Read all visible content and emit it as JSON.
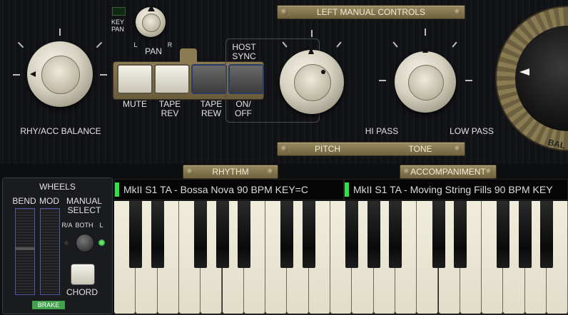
{
  "top": {
    "key_pan_label": "KEY\nPAN",
    "pan_label": "PAN",
    "pan_l": "L",
    "pan_r": "R",
    "rhy_acc_balance_label": "RHY/ACC BALANCE",
    "left_manual_controls_label": "LEFT MANUAL CONTROLS",
    "host_sync_label": "HOST\nSYNC",
    "buttons": [
      {
        "label": "MUTE",
        "state": "on"
      },
      {
        "label": "TAPE\nREV",
        "state": "on"
      },
      {
        "label": "TAPE\nREW",
        "state": "off"
      },
      {
        "label": "ON/\nOFF",
        "state": "off"
      }
    ],
    "hi_pass_label": "HI PASS",
    "low_pass_label": "LOW PASS",
    "pitch_label": "PITCH",
    "tone_label": "TONE",
    "balance_partial_label": "BAL"
  },
  "sections": {
    "rhythm_label": "RHYTHM",
    "accompaniment_label": "ACCOMPANIMENT"
  },
  "displays": {
    "rhythm_text": "MkII S1 TA - Bossa Nova 90 BPM KEY=C",
    "accompaniment_text": "MkII S1 TA - Moving String Fills 90 BPM KEY",
    "led_color": "#2ee04a"
  },
  "wheels": {
    "title": "WHEELS",
    "bend_label": "BEND",
    "mod_label": "MOD",
    "manual_select_label": "MANUAL\nSELECT",
    "ra_label": "R/A",
    "both_label": "BOTH",
    "l_label": "L",
    "chord_label": "CHORD",
    "brake_label": "BRAKE"
  },
  "colors": {
    "plate": "#8a7b52",
    "brake_green": "#3fa24a"
  }
}
